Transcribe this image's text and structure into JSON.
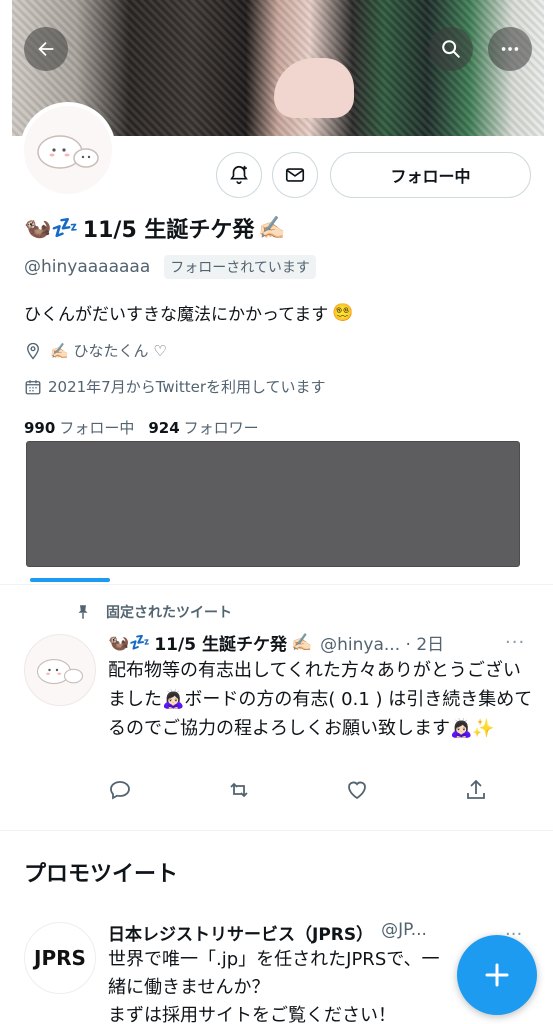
{
  "profile": {
    "display_name": "11/5 生誕チケ発",
    "display_name_prefix_emoji": "🦦💤",
    "display_name_suffix_emoji": "✍🏻",
    "handle": "@hinyaaaaaaa",
    "follows_you_label": "フォローされています",
    "bio_text": "ひくんがだいすきな魔法にかかってます",
    "bio_emoji": "😵‍💫",
    "location": "✍🏻 ひなたくん ♡",
    "joined": "2021年7月からTwitterを利用しています",
    "following_count": "990",
    "following_label": "フォロー中",
    "followers_count": "924",
    "followers_label": "フォロワー"
  },
  "actions": {
    "follow_button_label": "フォロー中"
  },
  "pinned_tweet": {
    "pinned_label": "固定されたツイート",
    "name_prefix_emoji": "🦦💤",
    "name": "11/5 生誕チケ発",
    "name_suffix_emoji": "✍🏻",
    "meta": "@hinya... · 2日",
    "more": "···",
    "body": "配布物等の有志出してくれた方々ありがとうございました🙇🏻‍♀️ボードの方の有志( 0.1 ) は引き続き集めてるのでご協力の程よろしくお願い致します🙇🏻‍♀️✨"
  },
  "promoted": {
    "section_title": "プロモツイート",
    "logo_text": "JPRS",
    "name": "日本レジストリサービス（JPRS）",
    "meta": "@JP...",
    "more": "···",
    "body_line1": "世界で唯一「.jp」を任されたJPRSで、一緒に働きませんか？",
    "body_line2": "まずは採用サイトをご覧ください！"
  },
  "colors": {
    "accent": "#1d9bf0",
    "secondary_text": "#536471",
    "border": "#cfd9de"
  },
  "icons": {
    "back": "arrow-left-icon",
    "search": "search-icon",
    "more": "more-horizontal-icon",
    "notify": "bell-plus-icon",
    "message": "envelope-icon",
    "location": "map-pin-icon",
    "calendar": "calendar-icon",
    "pin": "pin-icon",
    "reply": "reply-icon",
    "retweet": "retweet-icon",
    "like": "heart-icon",
    "share": "share-icon",
    "compose": "plus-icon"
  }
}
